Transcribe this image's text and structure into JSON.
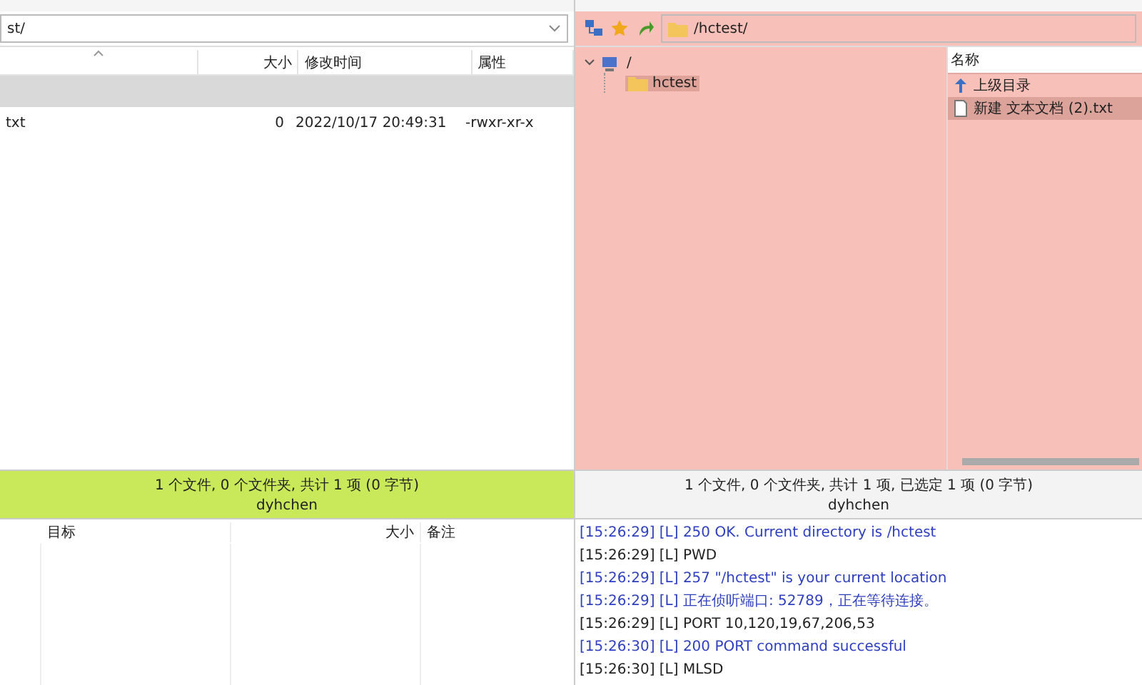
{
  "local_pane": {
    "path": "st/",
    "columns": [
      "大小",
      "修改时间",
      "属性"
    ],
    "rows": [
      {
        "selected": true
      },
      {
        "name": "txt",
        "size": "0",
        "modified": "2022/10/17 20:49:31",
        "attributes": "-rwxr-xr-x",
        "selected": false
      }
    ],
    "status": "1 个文件, 0 个文件夹, 共计 1 项 (0 字节)",
    "user": "dyhchen"
  },
  "remote_pane": {
    "path": "/hctest/",
    "tree": [
      {
        "label": "/",
        "expanded": true,
        "selected": false,
        "children": [
          {
            "label": "hctest",
            "selected": true
          }
        ]
      }
    ],
    "columns": [
      "名称"
    ],
    "files": [
      {
        "kind": "parent",
        "name": "上级目录",
        "selected": false
      },
      {
        "kind": "file",
        "name": "新建 文本文档 (2).txt",
        "selected": true
      }
    ],
    "status": "1 个文件, 0 个文件夹, 共计 1 项, 已选定 1 项 (0 字节)",
    "user": "dyhchen"
  },
  "queue": {
    "columns": [
      "目标",
      "大小",
      "备注"
    ]
  },
  "log": [
    {
      "kind": "response",
      "text": "[15:26:29] [L] 250 OK. Current directory is /hctest"
    },
    {
      "kind": "command",
      "text": "[15:26:29] [L] PWD"
    },
    {
      "kind": "response",
      "text": "[15:26:29] [L] 257 \"/hctest\" is your current location"
    },
    {
      "kind": "response",
      "text": "[15:26:29] [L] 正在侦听端口: 52789，正在等待连接。"
    },
    {
      "kind": "command",
      "text": "[15:26:29] [L] PORT 10,120,19,67,206,53"
    },
    {
      "kind": "response",
      "text": "[15:26:30] [L] 200 PORT command successful"
    },
    {
      "kind": "command",
      "text": "[15:26:30] [L] MLSD"
    }
  ]
}
